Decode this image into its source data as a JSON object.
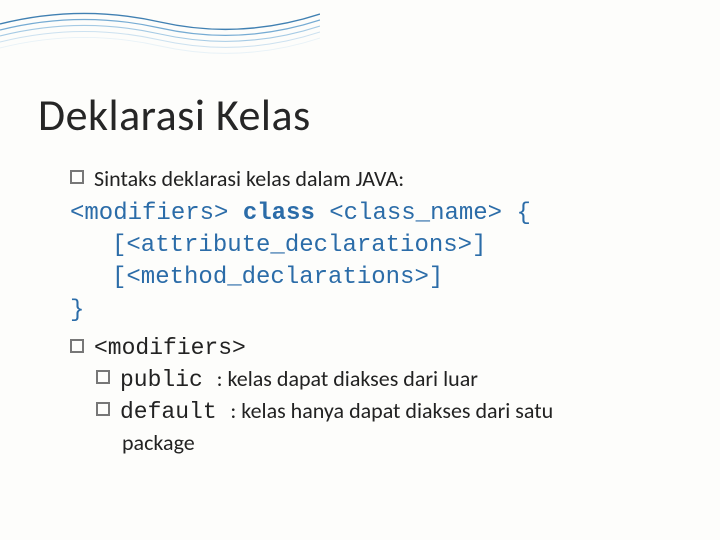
{
  "slide": {
    "title": "Deklarasi Kelas",
    "bullet1": "Sintaks deklarasi kelas dalam JAVA:",
    "code": {
      "line1_a": "<modifiers> ",
      "line1_kw": "class",
      "line1_b": " <class_name> {",
      "line2": "[<attribute_declarations>]",
      "line3": "[<method_declarations>]",
      "line4": "}"
    },
    "bullet2": "<modifiers>",
    "sub1_code": "public ",
    "sub1_text": ": kelas dapat diakses dari luar",
    "sub2_code": "default ",
    "sub2_text": ": kelas hanya dapat diakses dari satu",
    "sub2_cont": "package"
  }
}
